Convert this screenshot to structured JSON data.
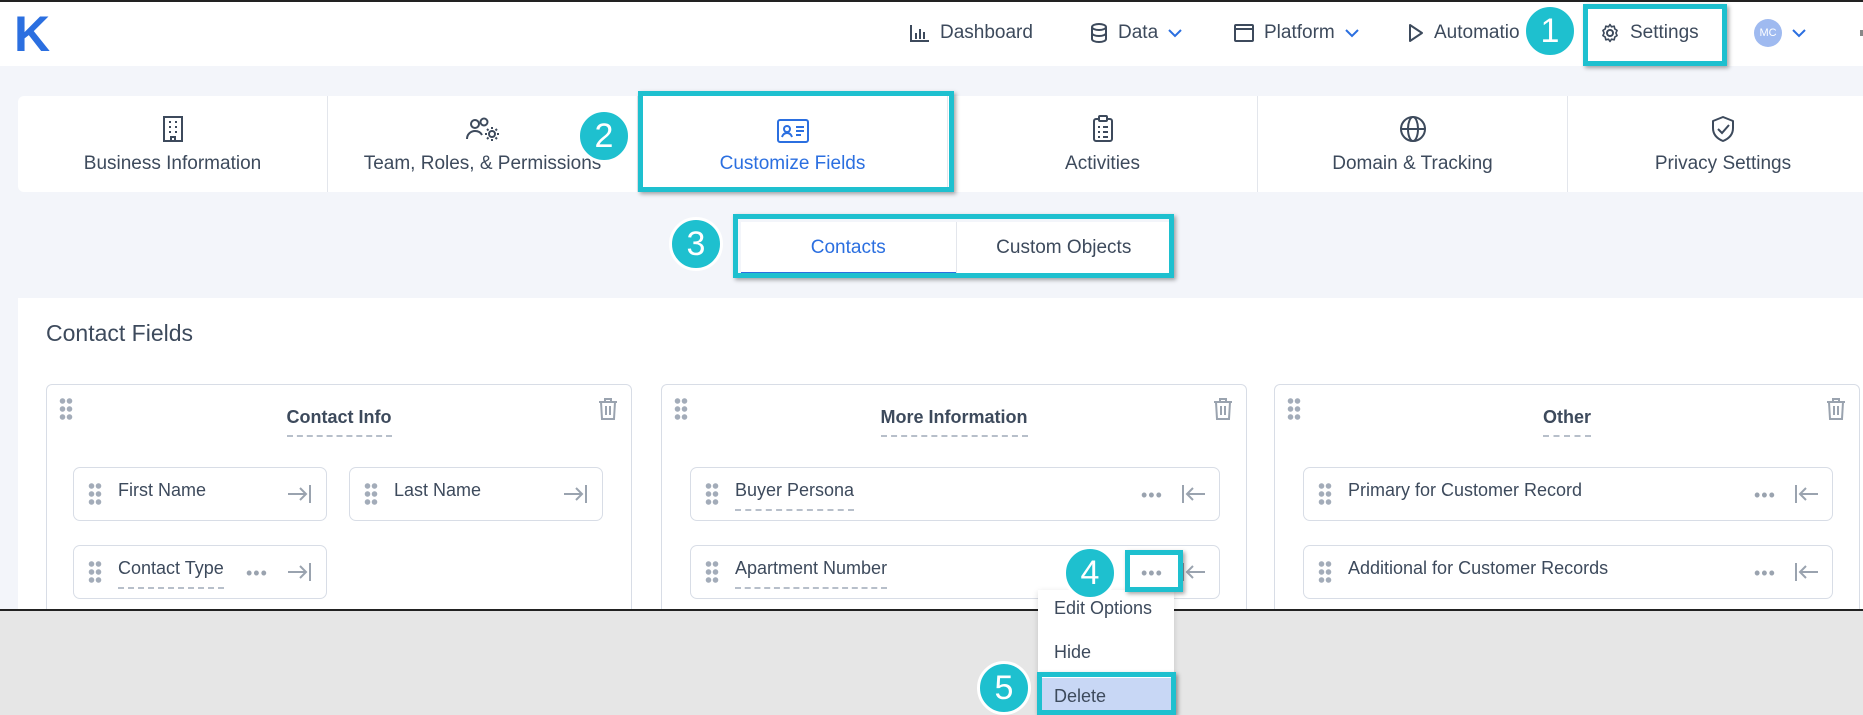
{
  "brand": {
    "logo": "K",
    "color": "#2b6fe0"
  },
  "topnav": {
    "items": [
      {
        "label": "Dashboard",
        "icon": "bar-chart-icon"
      },
      {
        "label": "Data",
        "icon": "database-icon"
      },
      {
        "label": "Platform",
        "icon": "window-icon"
      },
      {
        "label": "Automatio",
        "icon": "play-icon"
      },
      {
        "label": "Settings",
        "icon": "gear-icon"
      }
    ],
    "avatar_initials": "MC"
  },
  "settings_tabs": [
    {
      "label": "Business Information",
      "icon": "building-icon"
    },
    {
      "label": "Team, Roles, & Permissions",
      "icon": "team-gear-icon"
    },
    {
      "label": "Customize Fields",
      "icon": "id-card-icon",
      "active": true
    },
    {
      "label": "Activities",
      "icon": "clipboard-icon"
    },
    {
      "label": "Domain & Tracking",
      "icon": "globe-icon"
    },
    {
      "label": "Privacy Settings",
      "icon": "shield-check-icon"
    }
  ],
  "subtabs": [
    {
      "label": "Contacts",
      "active": true
    },
    {
      "label": "Custom Objects"
    }
  ],
  "panel": {
    "title": "Contact Fields",
    "groups": [
      {
        "title": "Contact Info",
        "fields": [
          "First Name",
          "Last Name",
          "Contact Type"
        ]
      },
      {
        "title": "More Information",
        "fields": [
          "Buyer Persona",
          "Apartment Number"
        ]
      },
      {
        "title": "Other",
        "fields": [
          "Primary for Customer Record",
          "Additional for Customer Records"
        ]
      }
    ]
  },
  "context_menu": {
    "items": [
      "Edit Options",
      "Hide",
      "Delete"
    ],
    "highlighted": "Delete"
  },
  "annotations": {
    "badges": [
      "1",
      "2",
      "3",
      "4",
      "5"
    ],
    "highlight_color": "#1ec0cf"
  },
  "more_glyph": "•••"
}
